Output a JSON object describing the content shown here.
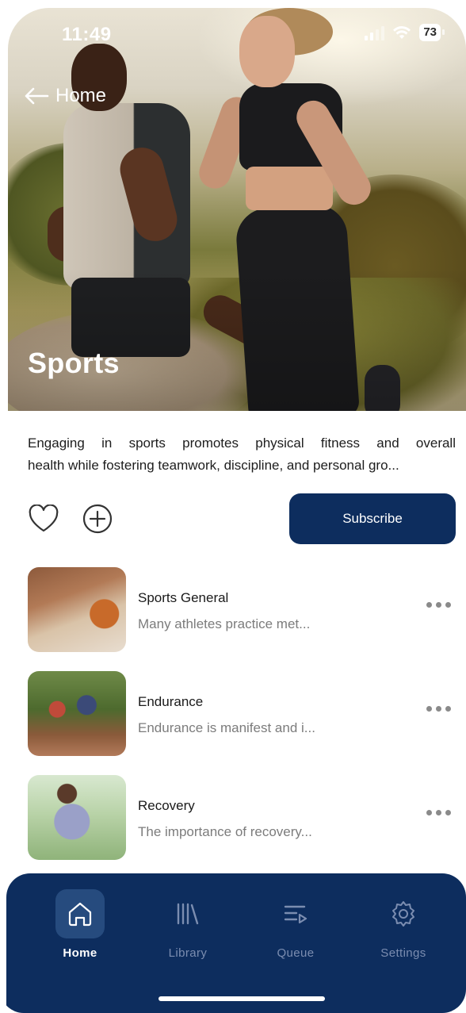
{
  "status_bar": {
    "time": "11:49",
    "battery": "73"
  },
  "header": {
    "back_label": "Home",
    "title": "Sports"
  },
  "description": {
    "line1": "Engaging in sports promotes physical fitness and overall",
    "line2": "health while fostering teamwork, discipline, and personal gro..."
  },
  "actions": {
    "subscribe_label": "Subscribe"
  },
  "episodes": [
    {
      "title": "Sports General",
      "subtitle": "Many athletes practice met..."
    },
    {
      "title": "Endurance",
      "subtitle": "Endurance is manifest and i..."
    },
    {
      "title": "Recovery",
      "subtitle": "The importance of recovery..."
    }
  ],
  "nav": {
    "items": [
      {
        "label": "Home",
        "icon": "home-icon",
        "active": true
      },
      {
        "label": "Library",
        "icon": "library-icon",
        "active": false
      },
      {
        "label": "Queue",
        "icon": "queue-icon",
        "active": false
      },
      {
        "label": "Settings",
        "icon": "gear-icon",
        "active": false
      }
    ]
  },
  "colors": {
    "navy": "#0d2d5e",
    "active_nav_bg": "#264b7e",
    "inactive_nav_text": "#7b8db0"
  }
}
